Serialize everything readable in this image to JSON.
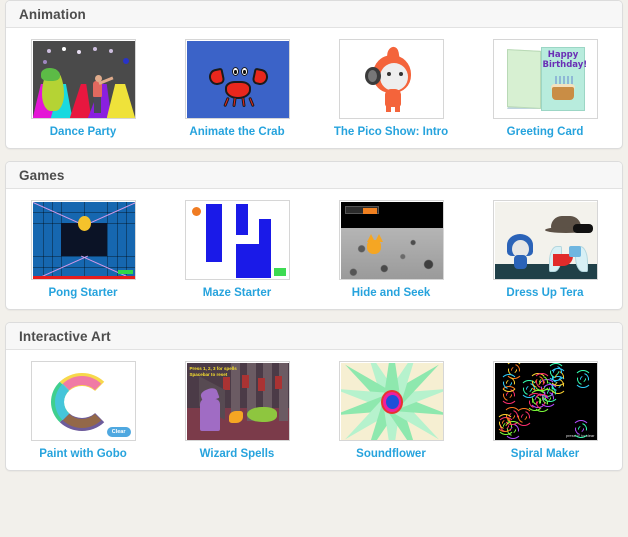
{
  "sections": [
    {
      "id": "animation",
      "title": "Animation",
      "projects": [
        {
          "label": "Dance Party",
          "thumb": "dance-party-thumbnail"
        },
        {
          "label": "Animate the Crab",
          "thumb": "animate-the-crab-thumbnail"
        },
        {
          "label": "The Pico Show: Intro",
          "thumb": "pico-show-thumbnail"
        },
        {
          "label": "Greeting Card",
          "thumb": "greeting-card-thumbnail"
        }
      ]
    },
    {
      "id": "games",
      "title": "Games",
      "projects": [
        {
          "label": "Pong Starter",
          "thumb": "pong-starter-thumbnail"
        },
        {
          "label": "Maze Starter",
          "thumb": "maze-starter-thumbnail"
        },
        {
          "label": "Hide and Seek",
          "thumb": "hide-and-seek-thumbnail"
        },
        {
          "label": "Dress Up Tera",
          "thumb": "dress-up-tera-thumbnail"
        }
      ]
    },
    {
      "id": "interactive-art",
      "title": "Interactive Art",
      "projects": [
        {
          "label": "Paint with Gobo",
          "thumb": "paint-with-gobo-thumbnail"
        },
        {
          "label": "Wizard Spells",
          "thumb": "wizard-spells-thumbnail"
        },
        {
          "label": "Soundflower",
          "thumb": "soundflower-thumbnail"
        },
        {
          "label": "Spiral Maker",
          "thumb": "spiral-maker-thumbnail"
        }
      ]
    }
  ],
  "thumb_text": {
    "greeting_card_line1": "Happy",
    "greeting_card_line2": "Birthday!",
    "paint_clear_button": "Clear",
    "wizard_hint_line1": "Press 1, 2, 3 for spells",
    "wizard_hint_line2": "Spacebar to reset",
    "spiral_hint": "press 'c' to clear"
  },
  "colors": {
    "label_link": "#26a3dd",
    "section_title": "#4d4d4d",
    "header_bg": "#f7f7f7",
    "card_bg": "#ffffff",
    "page_bg": "#f2f0eb",
    "border": "#dcdcdc"
  }
}
